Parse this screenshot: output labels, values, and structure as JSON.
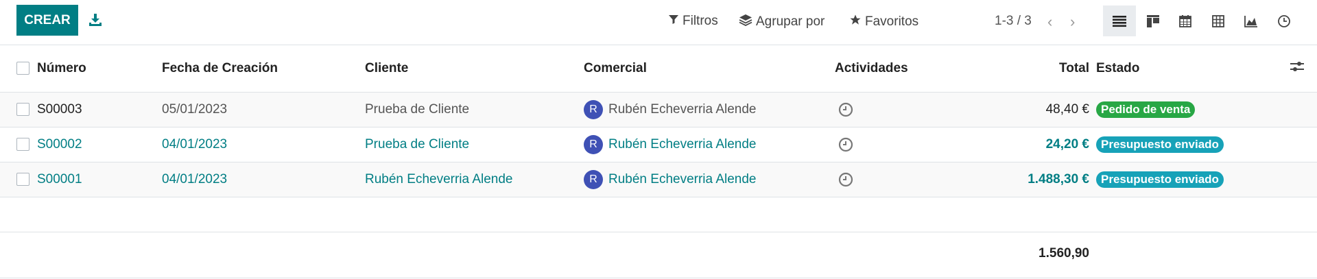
{
  "toolbar": {
    "create_label": "CREAR",
    "filters_label": "Filtros",
    "group_by_label": "Agrupar por",
    "favorites_label": "Favoritos",
    "pager": "1-3 / 3"
  },
  "views": [
    "list-view-icon",
    "kanban-view-icon",
    "calendar-view-icon",
    "pivot-view-icon",
    "graph-view-icon",
    "activity-view-icon"
  ],
  "columns": {
    "number": "Número",
    "date": "Fecha de Creación",
    "customer": "Cliente",
    "salesperson": "Comercial",
    "activities": "Actividades",
    "total": "Total",
    "status": "Estado"
  },
  "rows": [
    {
      "number": "S00003",
      "date": "05/01/2023",
      "customer": "Prueba de Cliente",
      "avatar": "R",
      "salesperson": "Rubén Echeverria Alende",
      "total": "48,40 €",
      "status": "Pedido de venta"
    },
    {
      "number": "S00002",
      "date": "04/01/2023",
      "customer": "Prueba de Cliente",
      "avatar": "R",
      "salesperson": "Rubén Echeverria Alende",
      "total": "24,20 €",
      "status": "Presupuesto enviado"
    },
    {
      "number": "S00001",
      "date": "04/01/2023",
      "customer": "Rubén Echeverria Alende",
      "avatar": "R",
      "salesperson": "Rubén Echeverria Alende",
      "total": "1.488,30 €",
      "status": "Presupuesto enviado"
    }
  ],
  "footer": {
    "total": "1.560,90"
  },
  "colors": {
    "primary": "#017e84",
    "status_sale": "#28a745",
    "status_sent": "#17a2b8",
    "avatar": "#3f51b5"
  }
}
